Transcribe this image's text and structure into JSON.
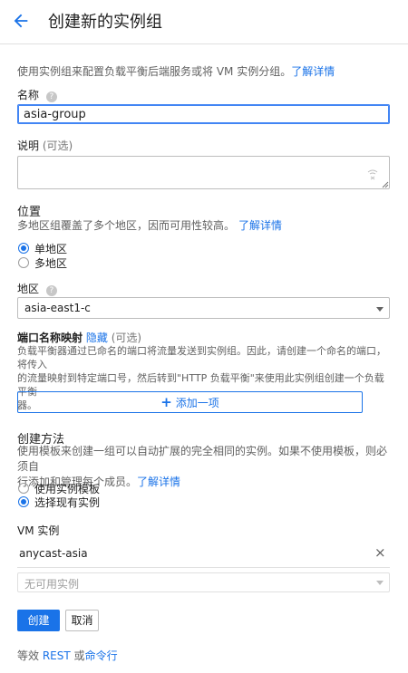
{
  "header": {
    "title": "创建新的实例组"
  },
  "intro": {
    "text": "使用实例组来配置负载平衡后端服务或将 VM 实例分组。",
    "link": "了解详情"
  },
  "name": {
    "label": "名称",
    "value": "asia-group"
  },
  "description": {
    "label": "说明",
    "optional": "(可选)",
    "value": ""
  },
  "location": {
    "label": "位置",
    "text": "多地区组覆盖了多个地区，因而可用性较高。",
    "link": "了解详情",
    "options": [
      "单地区",
      "多地区"
    ],
    "selected": "单地区"
  },
  "zone": {
    "label": "地区",
    "value": "asia-east1-c"
  },
  "port_mapping": {
    "label": "端口名称映射",
    "hide": "隐藏",
    "optional": "(可选)",
    "text_line1": "负载平衡器通过已命名的端口将流量发送到实例组。因此，请创建一个命名的端口，将传入",
    "text_line2": "的流量映射到特定端口号，然后转到\"HTTP 负载平衡\"来使用此实例组创建一个负载平衡",
    "text_line3": "器。",
    "add_label": "添加一项"
  },
  "creation": {
    "label": "创建方法",
    "text_line1": "使用模板来创建一组可以自动扩展的完全相同的实例。如果不使用模板，则必须自",
    "text_line2": "行添加和管理每个成员。",
    "link": "了解详情",
    "options": [
      "使用实例模板",
      "选择现有实例"
    ],
    "selected": "选择现有实例"
  },
  "vm": {
    "label": "VM 实例",
    "items": [
      "anycast-asia"
    ],
    "remove_glyph": "×",
    "select_placeholder": "无可用实例"
  },
  "actions": {
    "create": "创建",
    "cancel": "取消"
  },
  "footer": {
    "prefix": "等效",
    "rest": "REST",
    "or": "或",
    "cmd": "命令行"
  },
  "colors": {
    "accent": "#1a73e8",
    "focus": "#4285f4"
  }
}
